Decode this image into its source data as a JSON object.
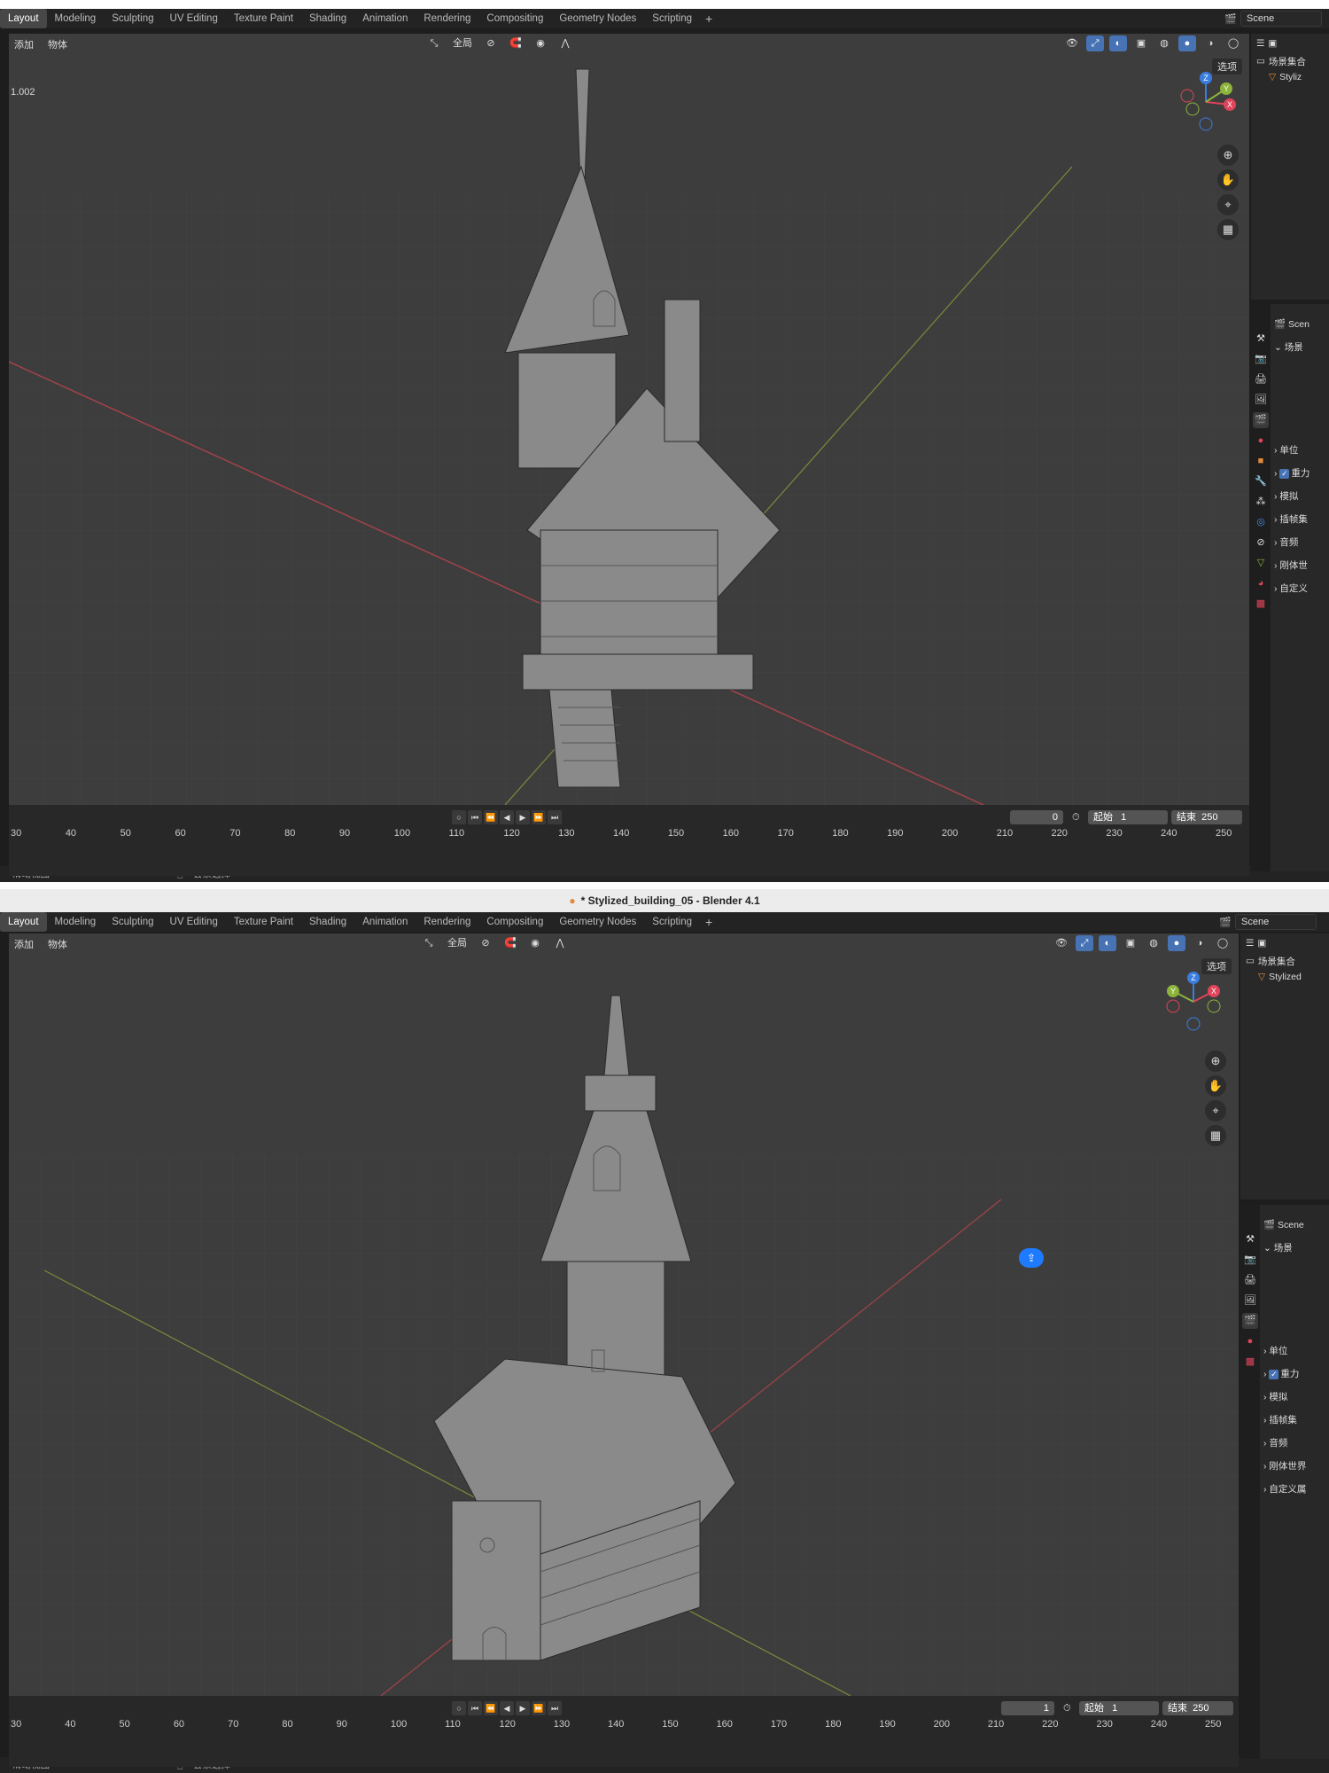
{
  "workspace_tabs": [
    "Layout",
    "Modeling",
    "Sculpting",
    "UV Editing",
    "Texture Paint",
    "Shading",
    "Animation",
    "Rendering",
    "Compositing",
    "Geometry Nodes",
    "Scripting"
  ],
  "add_tab": "+",
  "scene_name": "Scene",
  "menu": {
    "add": "添加",
    "object": "物体"
  },
  "transform_orientation": "全局",
  "options_label": "选项",
  "viewport_value": "1.002",
  "outliner": {
    "collection": "场景集合",
    "object_1": "Styliz",
    "object_2": "Stylized"
  },
  "props": {
    "scene_label_1": "Scen",
    "scene_label_2": "Scene",
    "section_scene": "场景",
    "items": [
      "单位",
      "重力",
      "模拟",
      "插帧集",
      "音频",
      "刚体世界",
      "自定义属"
    ],
    "items_short": [
      "单位",
      "重力",
      "模拟",
      "插帧集",
      "音频",
      "刚体世",
      "自定义"
    ]
  },
  "timeline": {
    "current_frame_1": "0",
    "current_frame_2": "1",
    "start_label": "起始",
    "start_value": "1",
    "end_label": "结束",
    "end_value": "250",
    "ticks": [
      "30",
      "40",
      "50",
      "60",
      "70",
      "80",
      "90",
      "100",
      "110",
      "120",
      "130",
      "140",
      "150",
      "160",
      "170",
      "180",
      "190",
      "200",
      "210",
      "220",
      "230",
      "240",
      "250"
    ]
  },
  "status": {
    "left": "滑动视图",
    "middle": "套索选择"
  },
  "window_title": "* Stylized_building_05 - Blender 4.1",
  "gizmo_axes": {
    "z": "Z",
    "y": "Y",
    "x": "X"
  },
  "colors": {
    "accent": "#4772b3",
    "x_axis": "#e0435a",
    "y_axis": "#8cb43a",
    "z_axis": "#3a7de0"
  }
}
